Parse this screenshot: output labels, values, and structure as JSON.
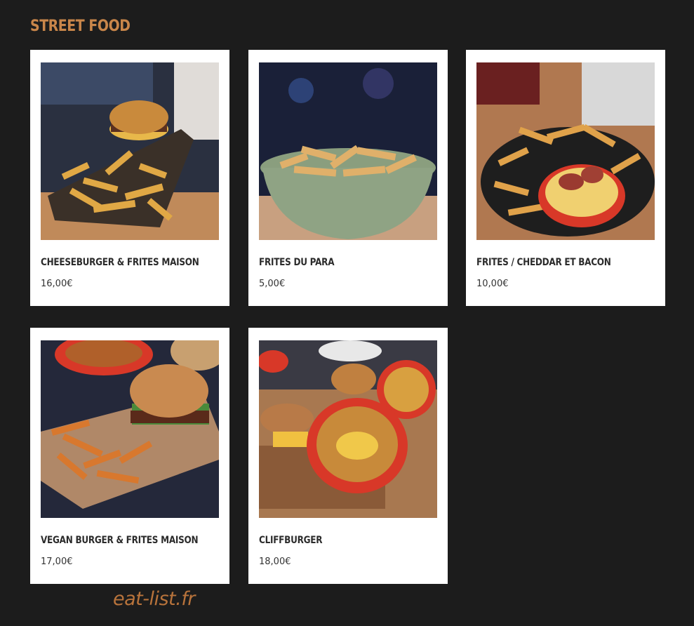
{
  "section": {
    "title": "STREET FOOD"
  },
  "items": [
    {
      "name": "CHEESEBURGER & FRITES MAISON",
      "price": "16,00€",
      "photo_icon": "burger-fries-photo"
    },
    {
      "name": "FRITES DU PARA",
      "price": "5,00€",
      "photo_icon": "fries-bowl-photo"
    },
    {
      "name": "FRITES / CHEDDAR ET BACON",
      "price": "10,00€",
      "photo_icon": "cheddar-bacon-fries-photo"
    },
    {
      "name": "VEGAN BURGER & FRITES MAISON",
      "price": "17,00€",
      "photo_icon": "vegan-burger-photo"
    },
    {
      "name": "CLIFFBURGER",
      "price": "18,00€",
      "photo_icon": "cliffburger-photo"
    }
  ],
  "watermark": {
    "text": "eat-list.fr"
  },
  "colors": {
    "background": "#1c1c1c",
    "accent": "#c9864a",
    "card": "#ffffff",
    "watermark": "#b8733b"
  }
}
